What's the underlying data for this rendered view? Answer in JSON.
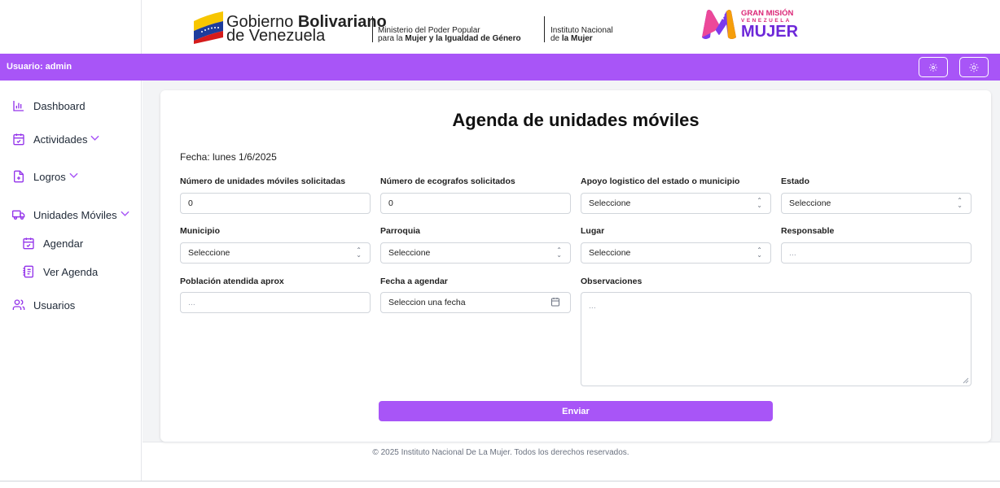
{
  "header": {
    "gov_line1_a": "Gobierno ",
    "gov_line1_b": "Bolivariano",
    "gov_line2": "de Venezuela",
    "ministry_line1": "Ministerio del Poder Popular",
    "ministry_line2_a": "para la ",
    "ministry_line2_b": "Mujer y la Igualdad de Género",
    "institute_line1": "Instituto Nacional",
    "institute_line2_a": "de ",
    "institute_line2_b": "la Mujer",
    "mision_line1": "GRAN MISIÓN",
    "mision_line2": "VENEZUELA",
    "mision_line3": "MUJER"
  },
  "topbar": {
    "user_label": "Usuario: admin",
    "settings_icon": "gear-icon",
    "theme_icon": "sun-icon"
  },
  "sidebar": {
    "items": [
      {
        "label": "Dashboard",
        "icon": "bar-chart-icon"
      },
      {
        "label": "Actividades",
        "icon": "calendar-check-icon",
        "expandable": true
      },
      {
        "label": "Logros",
        "icon": "file-plus-icon",
        "expandable": true
      },
      {
        "label": "Unidades Móviles",
        "icon": "truck-icon",
        "expandable": true
      },
      {
        "label": "Agendar",
        "icon": "calendar-check-icon"
      },
      {
        "label": "Ver Agenda",
        "icon": "notebook-icon"
      },
      {
        "label": "Usuarios",
        "icon": "users-icon"
      }
    ]
  },
  "form": {
    "title": "Agenda de unidades móviles",
    "date_text": "Fecha: lunes 1/6/2025",
    "fields": {
      "unidades": {
        "label": "Número de unidades móviles solicitadas",
        "value": "0"
      },
      "ecografos": {
        "label": "Número de ecografos solicitados",
        "value": "0"
      },
      "apoyo": {
        "label": "Apoyo logistico del estado o municipio",
        "value": "Seleccione"
      },
      "estado": {
        "label": "Estado",
        "value": "Seleccione"
      },
      "municipio": {
        "label": "Municipio",
        "value": "Seleccione"
      },
      "parroquia": {
        "label": "Parroquia",
        "value": "Seleccione"
      },
      "lugar": {
        "label": "Lugar",
        "value": "Seleccione"
      },
      "responsable": {
        "label": "Responsable",
        "placeholder": "..."
      },
      "poblacion": {
        "label": "Población atendida aprox",
        "placeholder": "..."
      },
      "fecha_agendar": {
        "label": "Fecha a agendar",
        "placeholder": "Seleccion una fecha"
      },
      "observaciones": {
        "label": "Observaciones",
        "placeholder": "..."
      }
    },
    "submit_label": "Enviar"
  },
  "footer": {
    "text": "© 2025 Instituto Nacional De La Mujer. Todos los derechos reservados."
  },
  "colors": {
    "accent": "#a855f7",
    "accent_dark": "#9333ea"
  }
}
